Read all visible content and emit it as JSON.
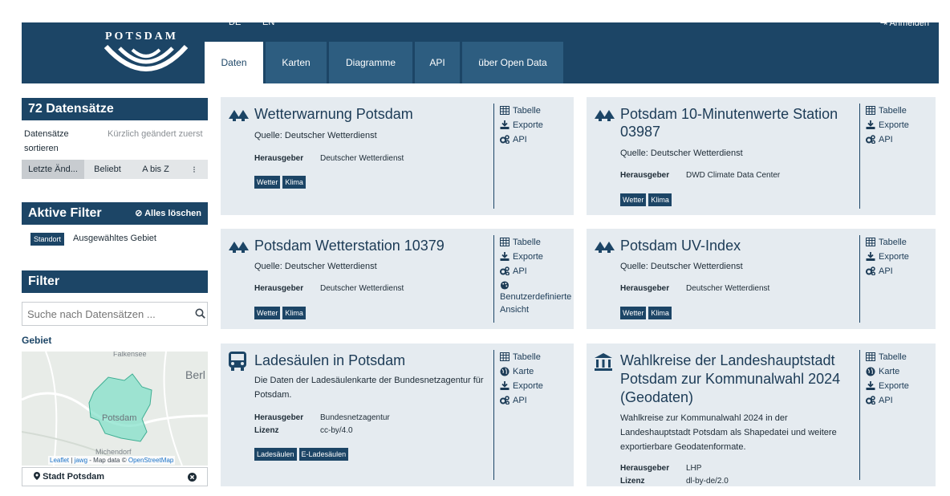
{
  "header": {
    "logo_text": "POTSDAM",
    "lang_de": "DE",
    "lang_en": "EN",
    "login": "Anmelden",
    "tabs": [
      {
        "label": "Daten"
      },
      {
        "label": "Karten"
      },
      {
        "label": "Diagramme"
      },
      {
        "label": "API"
      },
      {
        "label": "über Open Data"
      }
    ]
  },
  "sidebar": {
    "count_title": "72 Datensätze",
    "sort_label": "Datensätze sortieren",
    "sort_value": "Kürzlich geändert zuerst",
    "sort_buttons": [
      {
        "label": "Letzte Änd..."
      },
      {
        "label": "Beliebt"
      },
      {
        "label": "A bis Z"
      },
      {
        "label": "⁝"
      }
    ],
    "active_filter_title": "Aktive Filter",
    "clear_all": "⊘ Alles löschen",
    "filter_chip": "Standort",
    "filter_text": "Ausgewähltes Gebiet",
    "filter_title": "Filter",
    "search_placeholder": "Suche nach Datensätzen ...",
    "gebiet_label": "Gebiet",
    "map_labels": {
      "falkensee": "Falkensee",
      "berlin": "Berl",
      "potsdam": "Potsdam",
      "michendorf": "Michendorf"
    },
    "map_attribution": {
      "leaflet": "Leaflet",
      "sep": "|",
      "jawg": "jawg",
      "data": "- Map data ©",
      "osm": "OpenStreetMap"
    },
    "location": "Stadt Potsdam"
  },
  "cards": [
    {
      "title": "Wetterwarnung Potsdam",
      "source": "Quelle: Deutscher Wetterdienst",
      "publisher_label": "Herausgeber",
      "publisher": "Deutscher Wetterdienst",
      "tags": [
        "Wetter",
        "Klima"
      ],
      "actions": [
        "Tabelle",
        "Exporte",
        "API"
      ],
      "icon": "trees-icon"
    },
    {
      "title": "Potsdam 10-Minutenwerte Station 03987",
      "source": "Quelle: Deutscher Wetterdienst",
      "publisher_label": "Herausgeber",
      "publisher": "DWD Climate Data Center",
      "tags": [
        "Wetter",
        "Klima"
      ],
      "actions": [
        "Tabelle",
        "Exporte",
        "API"
      ],
      "icon": "trees-icon"
    },
    {
      "title": "Potsdam Wetterstation 10379",
      "source": "Quelle: Deutscher Wetterdienst",
      "publisher_label": "Herausgeber",
      "publisher": "Deutscher Wetterdienst",
      "tags": [
        "Wetter",
        "Klima"
      ],
      "actions": [
        "Tabelle",
        "Exporte",
        "API",
        "Benutzerdefinierte Ansicht"
      ],
      "icon": "trees-icon"
    },
    {
      "title": "Potsdam UV-Index",
      "source": "Quelle: Deutscher Wetterdienst",
      "publisher_label": "Herausgeber",
      "publisher": "Deutscher Wetterdienst",
      "tags": [
        "Wetter",
        "Klima"
      ],
      "actions": [
        "Tabelle",
        "Exporte",
        "API"
      ],
      "icon": "trees-icon"
    },
    {
      "title": "Ladesäulen in Potsdam",
      "source": "Die Daten der Ladesäulenkarte der Bundesnetzagentur für Potsdam.",
      "publisher_label": "Herausgeber",
      "publisher": "Bundesnetzagentur",
      "license_label": "Lizenz",
      "license": "cc-by/4.0",
      "tags": [
        "Ladesäulen",
        "E-Ladesäulen"
      ],
      "actions": [
        "Tabelle",
        "Karte",
        "Exporte",
        "API"
      ],
      "icon": "bus-icon"
    },
    {
      "title": "Wahlkreise der Landeshauptstadt Potsdam zur Kommunalwahl 2024 (Geodaten)",
      "source": "Wahlkreise zur Kommunalwahl 2024 in der Landeshauptstadt Potsdam als Shapedatei und weitere exportierbare Geodatenformate.",
      "publisher_label": "Herausgeber",
      "publisher": "LHP",
      "license_label": "Lizenz",
      "license": "dl-by-de/2.0",
      "actions": [
        "Tabelle",
        "Karte",
        "Exporte",
        "API"
      ],
      "icon": "government-building-icon"
    }
  ]
}
